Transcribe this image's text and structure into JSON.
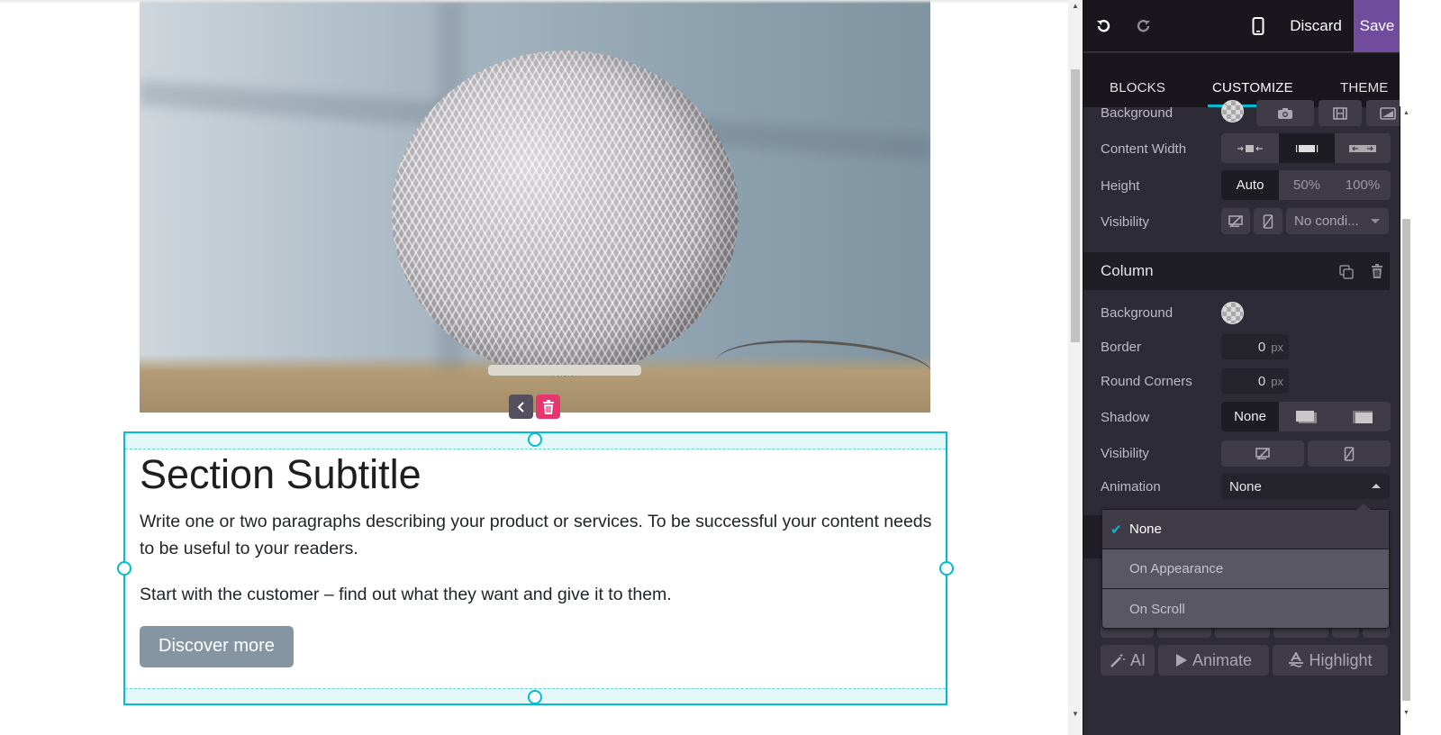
{
  "canvas": {
    "image_alt": "Smart speaker on a table",
    "snippet_tools": {
      "move_label": "move-left",
      "delete_label": "delete"
    },
    "heading": "Section Subtitle",
    "paragraph1": "Write one or two paragraphs describing your product or services. To be successful your content needs to be useful to your readers.",
    "paragraph2": "Start with the customer – find out what they want and give it to them.",
    "cta_button": "Discover more"
  },
  "toolbar": {
    "undo_icon": "undo-icon",
    "redo_icon": "redo-icon",
    "mobile_icon": "mobile-preview-icon",
    "discard_label": "Discard",
    "save_label": "Save",
    "save_color": "#714b9c"
  },
  "tabs": [
    {
      "label": "BLOCKS",
      "active": false
    },
    {
      "label": "CUSTOMIZE",
      "active": true
    },
    {
      "label": "THEME",
      "active": false
    }
  ],
  "accent_color": "#00bcd4",
  "section_options": {
    "background_label": "Background",
    "content_width_label": "Content Width",
    "content_width_options": [
      "small",
      "regular",
      "full"
    ],
    "content_width_selected": "regular",
    "height_label": "Height",
    "height_options": [
      "Auto",
      "50%",
      "100%"
    ],
    "height_selected": "Auto",
    "visibility_label": "Visibility",
    "visibility_condition": "No condi..."
  },
  "column": {
    "title": "Column",
    "background_label": "Background",
    "border_label": "Border",
    "border_value": "0",
    "border_unit": "px",
    "round_corners_label": "Round Corners",
    "round_corners_value": "0",
    "round_corners_unit": "px",
    "shadow_label": "Shadow",
    "shadow_options": [
      "None",
      "outset",
      "inset"
    ],
    "shadow_selected": "None",
    "visibility_label": "Visibility",
    "animation_label": "Animation",
    "animation_value": "None"
  },
  "animation_dropdown": {
    "options": [
      {
        "label": "None",
        "selected": true
      },
      {
        "label": "On Appearance",
        "selected": false
      },
      {
        "label": "On Scroll",
        "selected": false
      }
    ]
  },
  "text_tools": {
    "ai_label": "AI",
    "animate_label": "Animate",
    "highlight_label": "Highlight"
  }
}
